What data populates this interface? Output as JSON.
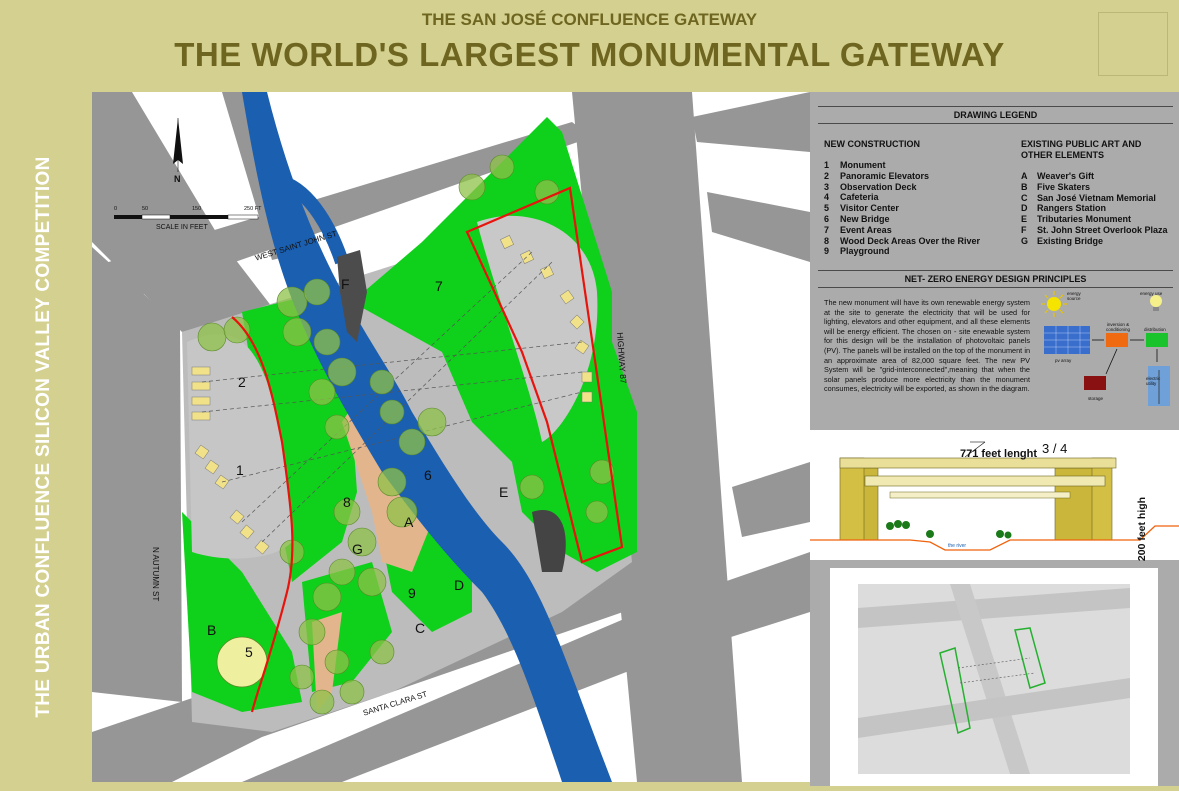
{
  "header": {
    "subtitle": "THE SAN JOSÉ CONFLUENCE GATEWAY",
    "title": "THE WORLD'S LARGEST MONUMENTAL GATEWAY"
  },
  "side_title": "THE URBAN CONFLUENCE SILICON VALLEY COMPETITION",
  "map": {
    "north_label": "N",
    "scale": {
      "ticks": [
        "0",
        "50",
        "150",
        "250 FT"
      ],
      "label": "SCALE IN FEET"
    },
    "streets": {
      "west_saint_john": "WEST SAINT JOHN ST",
      "highway": "HIGHWAY 87",
      "autumn": "N AUTUMN ST",
      "santa_clara": "SANTA CLARA ST"
    },
    "area_labels": [
      "1",
      "2",
      "5",
      "6",
      "7",
      "8",
      "9",
      "A",
      "B",
      "C",
      "D",
      "E",
      "F",
      "G"
    ]
  },
  "legend": {
    "heading": "DRAWING LEGEND",
    "new_construction": {
      "title": "NEW CONSTRUCTION",
      "items": [
        {
          "key": "1",
          "label": "Monument"
        },
        {
          "key": "2",
          "label": "Panoramic Elevators"
        },
        {
          "key": "3",
          "label": "Observation Deck"
        },
        {
          "key": "4",
          "label": "Cafeteria"
        },
        {
          "key": "5",
          "label": "Visitor Center"
        },
        {
          "key": "6",
          "label": "New Bridge"
        },
        {
          "key": "7",
          "label": "Event Areas"
        },
        {
          "key": "8",
          "label": "Wood Deck Areas Over the River"
        },
        {
          "key": "9",
          "label": "Playground"
        }
      ]
    },
    "existing": {
      "title_line1": "EXISTING PUBLIC ART AND",
      "title_line2": "OTHER ELEMENTS",
      "items": [
        {
          "key": "A",
          "label": "Weaver's Gift"
        },
        {
          "key": "B",
          "label": "Five Skaters"
        },
        {
          "key": "C",
          "label": "San José Vietnam Memorial"
        },
        {
          "key": "D",
          "label": "Rangers Station"
        },
        {
          "key": "E",
          "label": "Tributaries Monument"
        },
        {
          "key": "F",
          "label": "St. John Street Overlook Plaza"
        },
        {
          "key": "G",
          "label": "Existing Bridge"
        }
      ]
    }
  },
  "net_zero": {
    "heading": "NET- ZERO ENERGY DESIGN PRINCIPLES",
    "text": "The new monument will have its own renewable energy system at the site to generate the electricity that will be used for lighting, elevators and other equipment, and all these elements will be energy efficient. The chosen on - site enewable system for this design will be the installation of photovoltaic panels (PV). The panels will be installed on the top of the monument in an approximate area of 82,000 square feet. The new PV System will be \"grid-interconnected\",meaning that when the solar panels produce more electricity than the monument consumes, electricity will be exported, as shown in the diagram.",
    "diagram": {
      "energy_source": "energy source",
      "energy_use": "energy use",
      "pv_array": "pv array",
      "inversion": "inversion & conditioning",
      "distribution": "distribution",
      "storage": "storage",
      "utility": "electric utility"
    }
  },
  "elevation": {
    "length_label": "771 feet lenght",
    "fraction": "3 / 4",
    "height_label": "200 feet high",
    "river_label": "the river"
  },
  "colors": {
    "header_bg": "#d4d08f",
    "title_text": "#6e6620",
    "green": "#0fd01a",
    "river": "#1b5fb0",
    "road": "#969696",
    "boundary": "#e8130c"
  }
}
